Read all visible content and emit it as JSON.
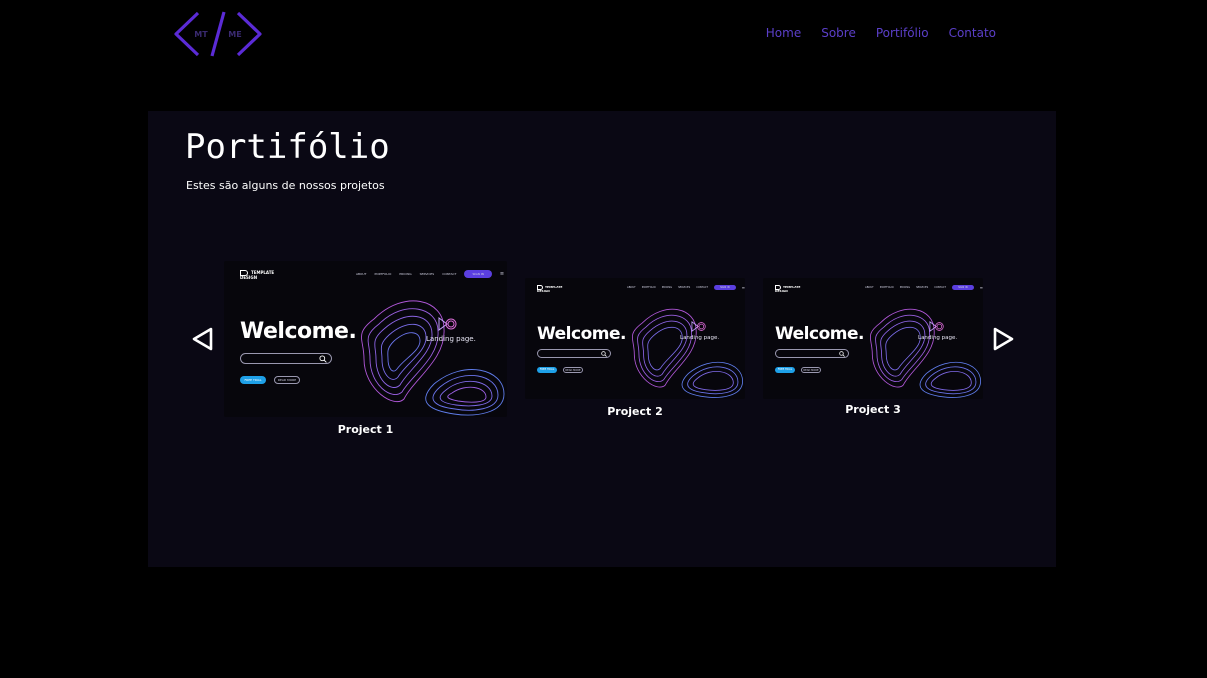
{
  "brand": {
    "logo_text_left": "MT",
    "logo_text_right": "ME",
    "accent": "#5b2bd6"
  },
  "nav": {
    "items": [
      {
        "label": "Home"
      },
      {
        "label": "Sobre"
      },
      {
        "label": "Portifólio"
      },
      {
        "label": "Contato"
      }
    ],
    "color": "#5b3fc9"
  },
  "portfolio": {
    "title": "Portifólio",
    "subtitle": "Estes são alguns de nossos projetos",
    "prev_icon": "chevron-left-outline",
    "next_icon": "chevron-right-outline",
    "projects": [
      {
        "caption": "Project 1",
        "thumb": {
          "logo": "TEMPLATE\nDESIGN",
          "nav": [
            "ABOUT",
            "PORTFOLIO",
            "PRICING",
            "SERVICES",
            "CONTACT"
          ],
          "button": "SIGN IN",
          "welcome": "Welcome.",
          "landing": "Landing page.",
          "free_trial": "FREE TRIAL",
          "read_more": "READ MORE"
        }
      },
      {
        "caption": "Project 2",
        "thumb": {
          "logo": "TEMPLATE\nDESIGN",
          "nav": [
            "ABOUT",
            "PORTFOLIO",
            "PRICING",
            "SERVICES",
            "CONTACT"
          ],
          "button": "SIGN IN",
          "welcome": "Welcome.",
          "landing": "Landing page.",
          "free_trial": "FREE TRIAL",
          "read_more": "READ MORE"
        }
      },
      {
        "caption": "Project 3",
        "thumb": {
          "logo": "TEMPLATE\nDESIGN",
          "nav": [
            "ABOUT",
            "PORTFOLIO",
            "PRICING",
            "SERVICES",
            "CONTACT"
          ],
          "button": "SIGN IN",
          "welcome": "Welcome.",
          "landing": "Landing page.",
          "free_trial": "FREE TRIAL",
          "read_more": "READ MORE"
        }
      }
    ]
  }
}
